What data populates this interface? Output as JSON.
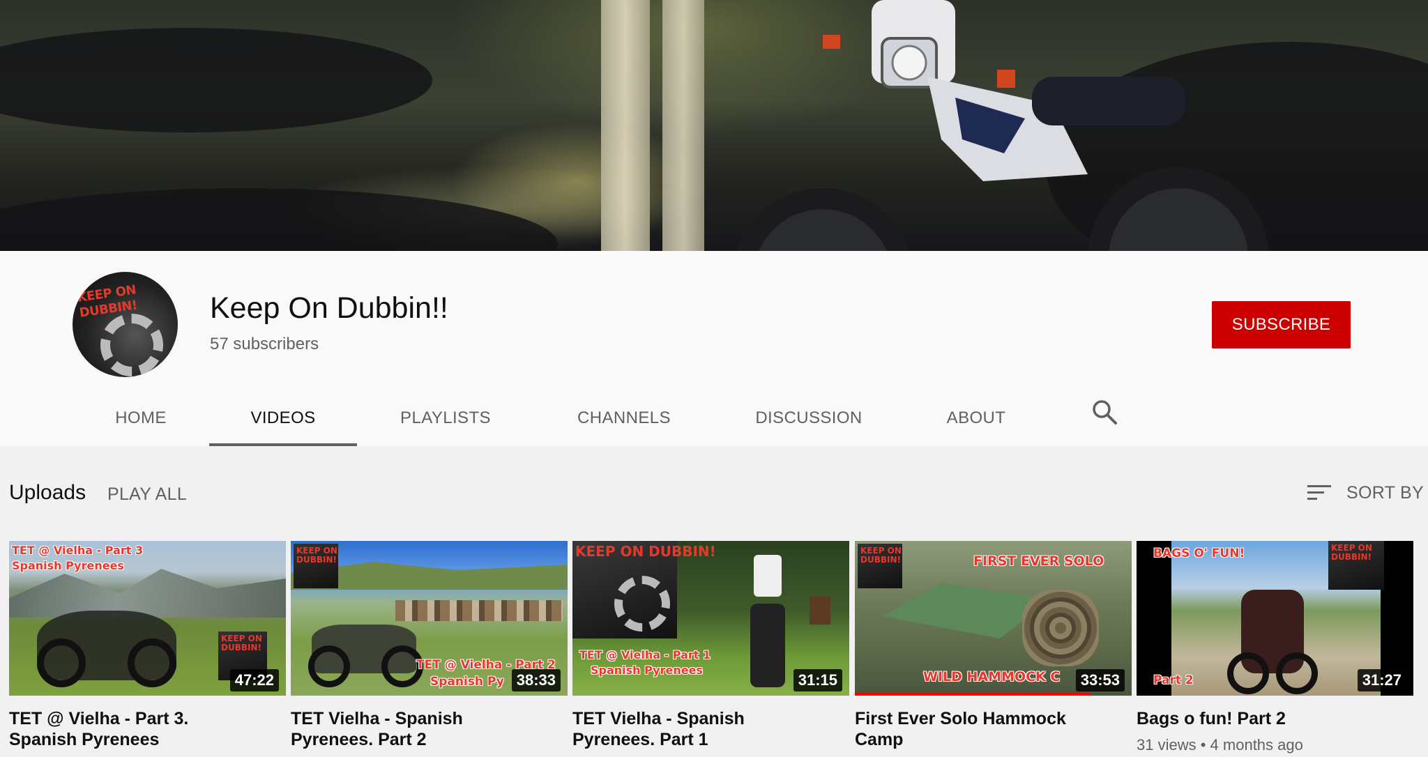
{
  "channel": {
    "name": "Keep On Dubbin!!",
    "subscribers": "57 subscribers",
    "avatar_text": "KEEP ON DUBBIN!",
    "subscribe_label": "SUBSCRIBE"
  },
  "tabs": [
    {
      "label": "HOME"
    },
    {
      "label": "VIDEOS"
    },
    {
      "label": "PLAYLISTS"
    },
    {
      "label": "CHANNELS"
    },
    {
      "label": "DISCUSSION"
    },
    {
      "label": "ABOUT"
    }
  ],
  "active_tab": "VIDEOS",
  "uploads": {
    "title": "Uploads",
    "play_all": "PLAY ALL",
    "sort_by": "SORT BY"
  },
  "videos": [
    {
      "title_line1": "TET @ Vielha - Part 3.",
      "title_line2": "Spanish Pyrenees",
      "duration": "47:22",
      "overlay_line1": "TET @ Vielha - Part 3",
      "overlay_line2": "Spanish Pyrenees",
      "logo": "KEEP ON DUBBIN!"
    },
    {
      "title_line1": "TET Vielha - Spanish",
      "title_line2": "Pyrenees. Part 2",
      "duration": "38:33",
      "overlay_line1": "TET @ Vielha - Part 2",
      "overlay_line2": "Spanish Py",
      "logo": "KEEP ON DUBBIN!"
    },
    {
      "title_line1": "TET Vielha - Spanish",
      "title_line2": "Pyrenees. Part 1",
      "duration": "31:15",
      "overlay_line1": "TET @ Vielha - Part 1",
      "overlay_line2": "Spanish Pyrenees",
      "logo": "KEEP ON DUBBIN!"
    },
    {
      "title_line1": "First Ever Solo Hammock",
      "title_line2": "Camp",
      "duration": "33:53",
      "overlay_line1": "FIRST EVER SOLO",
      "overlay_line2": "WILD HAMMOCK C",
      "logo": "KEEP ON DUBBIN!",
      "progress": 0.85
    },
    {
      "title_line1": "Bags o fun! Part 2",
      "title_line2": "",
      "duration": "31:27",
      "overlay_line1": "BAGS O' FUN!",
      "overlay_line2": "Part 2",
      "logo": "KEEP ON DUBBIN!",
      "views": "31 views",
      "age": "4 months ago"
    }
  ],
  "colors": {
    "subscribe": "#cc0000",
    "progress": "#ff0000",
    "overlay_red": "#e8372b"
  }
}
